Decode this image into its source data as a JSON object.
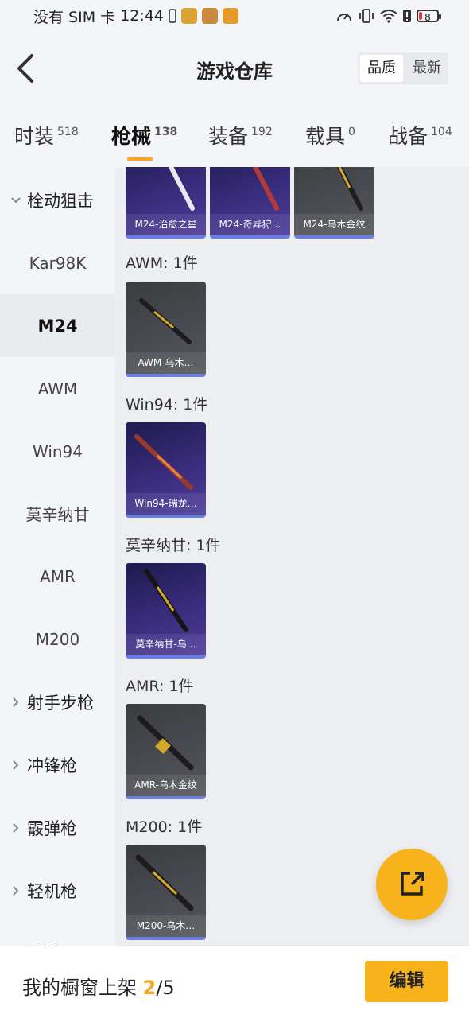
{
  "status_bar": {
    "carrier": "没有 SIM 卡",
    "time": "12:44",
    "battery": "8"
  },
  "header": {
    "title": "游戏仓库",
    "sort_options": [
      "品质",
      "最新"
    ],
    "sort_active": "品质"
  },
  "tabs": [
    {
      "label": "时装",
      "count": "518"
    },
    {
      "label": "枪械",
      "count": "138"
    },
    {
      "label": "装备",
      "count": "192"
    },
    {
      "label": "载具",
      "count": "0"
    },
    {
      "label": "战备",
      "count": "104"
    }
  ],
  "active_tab": "枪械",
  "sidebar": {
    "group_open": "栓动狙击",
    "subitems": [
      "Kar98K",
      "M24",
      "AWM",
      "Win94",
      "莫辛纳甘",
      "AMR",
      "M200"
    ],
    "active_item": "M24",
    "groups_closed": [
      "射手步枪",
      "冲锋枪",
      "霰弹枪",
      "轻机枪",
      "近战"
    ]
  },
  "content": {
    "top_cards": [
      "M24-治愈之星",
      "M24-奇异狩…",
      "M24-乌木金纹"
    ],
    "sections": [
      {
        "label": "AWM: 1件",
        "card": "AWM-乌木…",
        "style": "grey"
      },
      {
        "label": "Win94: 1件",
        "card": "Win94-瑞龙…",
        "style": "purple"
      },
      {
        "label": "莫辛纳甘: 1件",
        "card": "莫辛纳甘-乌…",
        "style": "purple"
      },
      {
        "label": "AMR: 1件",
        "card": "AMR-乌木金纹",
        "style": "grey"
      },
      {
        "label": "M200: 1件",
        "card": "M200-乌木…",
        "style": "grey"
      }
    ]
  },
  "bottom_bar": {
    "shelf_label": "我的橱窗上架",
    "shelf_current": "2",
    "shelf_total": "/5",
    "edit_label": "编辑"
  },
  "colors": {
    "accent": "#f8b21c",
    "card_border": "#6a7de0",
    "card_purple": "#3a2c7c",
    "card_grey": "#4a4c51"
  }
}
